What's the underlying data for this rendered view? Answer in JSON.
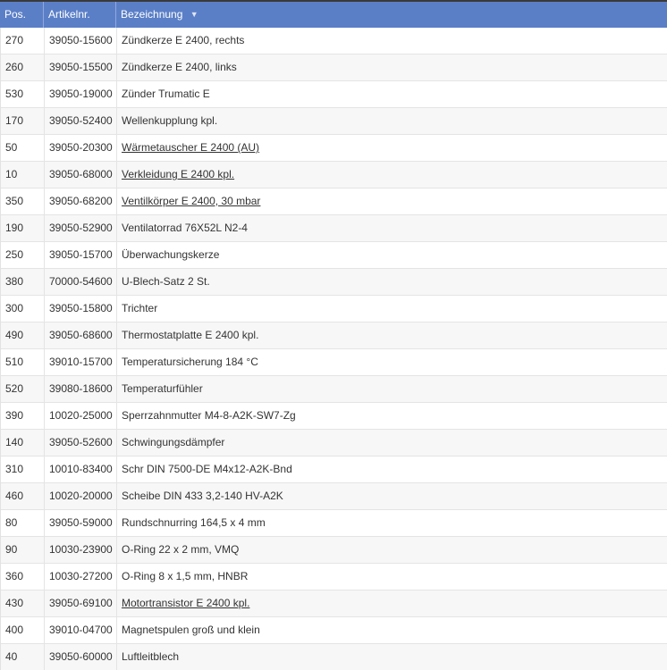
{
  "header": {
    "pos": "Pos.",
    "artikelnr": "Artikelnr.",
    "bezeichnung": "Bezeichnung",
    "sort_icon": "chevron-down-icon"
  },
  "rows": [
    {
      "pos": "270",
      "art": "39050-15600",
      "bez": "Zündkerze E 2400, rechts",
      "link": false
    },
    {
      "pos": "260",
      "art": "39050-15500",
      "bez": "Zündkerze E 2400, links",
      "link": false
    },
    {
      "pos": "530",
      "art": "39050-19000",
      "bez": "Zünder Trumatic E",
      "link": false
    },
    {
      "pos": "170",
      "art": "39050-52400",
      "bez": "Wellenkupplung kpl.",
      "link": false
    },
    {
      "pos": "50",
      "art": "39050-20300",
      "bez": "Wärmetauscher E 2400 (AU)",
      "link": true
    },
    {
      "pos": "10",
      "art": "39050-68000",
      "bez": "Verkleidung E 2400 kpl.",
      "link": true
    },
    {
      "pos": "350",
      "art": "39050-68200",
      "bez": "Ventilkörper E 2400, 30 mbar",
      "link": true
    },
    {
      "pos": "190",
      "art": "39050-52900",
      "bez": "Ventilatorrad 76X52L N2-4",
      "link": false
    },
    {
      "pos": "250",
      "art": "39050-15700",
      "bez": "Überwachungskerze",
      "link": false
    },
    {
      "pos": "380",
      "art": "70000-54600",
      "bez": "U-Blech-Satz 2 St.",
      "link": false
    },
    {
      "pos": "300",
      "art": "39050-15800",
      "bez": "Trichter",
      "link": false
    },
    {
      "pos": "490",
      "art": "39050-68600",
      "bez": "Thermostatplatte E 2400 kpl.",
      "link": false
    },
    {
      "pos": "510",
      "art": "39010-15700",
      "bez": "Temperatursicherung 184 °C",
      "link": false
    },
    {
      "pos": "520",
      "art": "39080-18600",
      "bez": "Temperaturfühler",
      "link": false
    },
    {
      "pos": "390",
      "art": "10020-25000",
      "bez": "Sperrzahnmutter M4-8-A2K-SW7-Zg",
      "link": false
    },
    {
      "pos": "140",
      "art": "39050-52600",
      "bez": "Schwingungsdämpfer",
      "link": false
    },
    {
      "pos": "310",
      "art": "10010-83400",
      "bez": "Schr DIN 7500-DE M4x12-A2K-Bnd",
      "link": false
    },
    {
      "pos": "460",
      "art": "10020-20000",
      "bez": "Scheibe DIN 433 3,2-140 HV-A2K",
      "link": false
    },
    {
      "pos": "80",
      "art": "39050-59000",
      "bez": "Rundschnurring 164,5 x 4 mm",
      "link": false
    },
    {
      "pos": "90",
      "art": "10030-23900",
      "bez": "O-Ring 22 x 2 mm, VMQ",
      "link": false
    },
    {
      "pos": "360",
      "art": "10030-27200",
      "bez": "O-Ring 8 x 1,5 mm, HNBR",
      "link": false
    },
    {
      "pos": "430",
      "art": "39050-69100",
      "bez": "Motortransistor E 2400 kpl.",
      "link": true
    },
    {
      "pos": "400",
      "art": "39010-04700",
      "bez": "Magnetspulen groß und klein",
      "link": false
    },
    {
      "pos": "40",
      "art": "39050-60000",
      "bez": "Luftleitblech",
      "link": false
    }
  ]
}
